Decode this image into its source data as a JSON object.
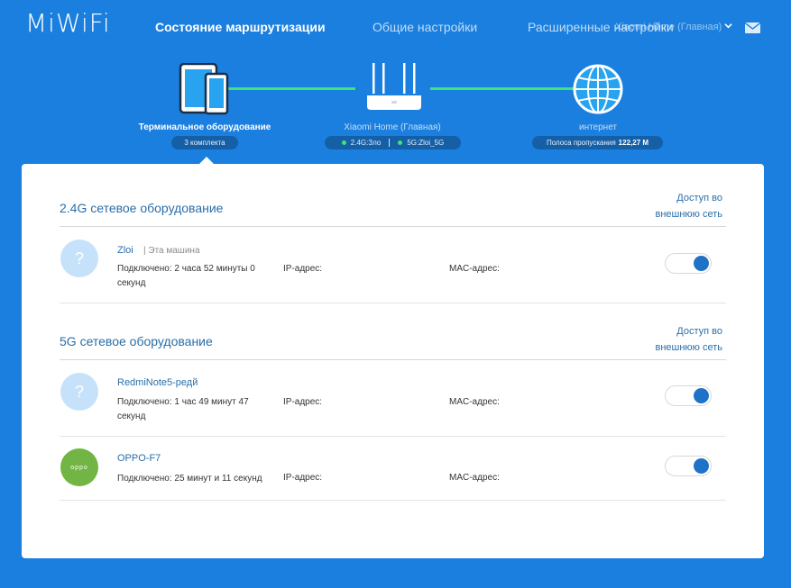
{
  "header": {
    "logo": "MiWiFi",
    "nav": {
      "active": "Состояние маршрутизации",
      "general": "Общие настройки",
      "advanced": "Расширенные настройки"
    },
    "router_select": "Xiaomi Home (Главная)",
    "icons": [
      "chevron-down-icon",
      "mail-icon"
    ]
  },
  "topology": {
    "devices": {
      "label": "Терминальное оборудование",
      "count": "3 комплекта"
    },
    "router": {
      "label": "Xiaomi Home (Главная)",
      "band24": "2.4G:Зло",
      "band5": "5G:Zloi_5G"
    },
    "internet": {
      "label": "интернет",
      "bandwidth_label": "Полоса пропускания",
      "bandwidth_value": "122,27 M"
    },
    "colors": {
      "link": "#3ee37a",
      "background": "#1a7fde"
    }
  },
  "sections": [
    {
      "title": "2.4G сетевое оборудование",
      "access_line1": "Доступ во",
      "access_line2": "внешнюю сеть",
      "devices": [
        {
          "name": "Zloi",
          "tag": "| Эта машина",
          "connected": "Подключено: 2 часа 52 минуты 0 секунд",
          "ip_label": "IP-адрес:",
          "mac_label": "MAC-адрес:",
          "avatar": "?",
          "access_enabled": true
        }
      ]
    },
    {
      "title": "5G сетевое оборудование",
      "access_line1": "Доступ во",
      "access_line2": "внешнюю сеть",
      "devices": [
        {
          "name": "RedmiNote5-редй",
          "connected": "Подключено: 1 час 49 минут 47 секунд",
          "ip_label": "IP-адрес:",
          "mac_label": "MAC-адрес:",
          "avatar": "?",
          "access_enabled": true
        },
        {
          "name": "OPPO-F7",
          "connected": "Подключено: 25 минут и 11 секунд",
          "ip_label": "IP-адрес:",
          "mac_label": "MAC-адрес:",
          "avatar": "oppo",
          "access_enabled": true
        }
      ]
    }
  ]
}
